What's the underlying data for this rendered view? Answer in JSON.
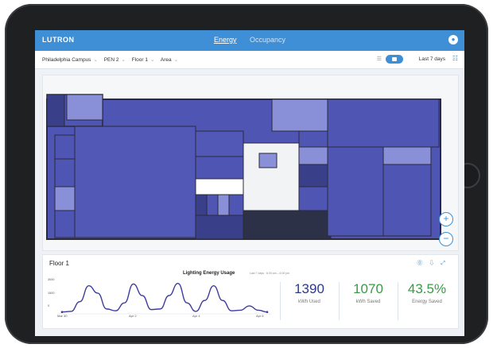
{
  "app": {
    "logo": "LUTRON",
    "tabs": [
      {
        "label": "Energy",
        "active": true
      },
      {
        "label": "Occupancy",
        "active": false
      }
    ],
    "accent": "#3e8fd6"
  },
  "filters": {
    "breadcrumb": [
      "Philadelphia Campus",
      "PEN 2",
      "Floor 1",
      "Area"
    ],
    "period": "Last 7 days"
  },
  "panel": {
    "floor_title": "Floor 1",
    "chart_title": "Lighting Energy Usage",
    "chart_subtitle": "Last 7 days · 6:00 am – 6:00 pm",
    "stats": [
      {
        "value": "1390",
        "label": "kWh Used",
        "color": "#2d3a8c"
      },
      {
        "value": "1070",
        "label": "kWh Saved",
        "color": "#3a9a46"
      },
      {
        "value": "43.5%",
        "label": "Energy Saved",
        "color": "#3a9a46"
      }
    ]
  },
  "chart_data": {
    "type": "line",
    "title": "Lighting Energy Usage",
    "subtitle": "Last 7 days · 6:00 am – 6:00 pm",
    "yticks": [
      "3000",
      "1500",
      "0"
    ],
    "xticks": [
      "Mar 30",
      "Apr 2",
      "Apr 4",
      "Apr 6"
    ],
    "ylim": [
      0,
      3000
    ],
    "series": [
      {
        "color": "#3d3c9e",
        "values": [
          150,
          200,
          1000,
          2300,
          1700,
          400,
          250,
          900,
          2450,
          1500,
          350,
          400,
          1500,
          2500,
          900,
          200,
          1100,
          2300,
          1100,
          250,
          300,
          650,
          300,
          150
        ]
      }
    ]
  }
}
